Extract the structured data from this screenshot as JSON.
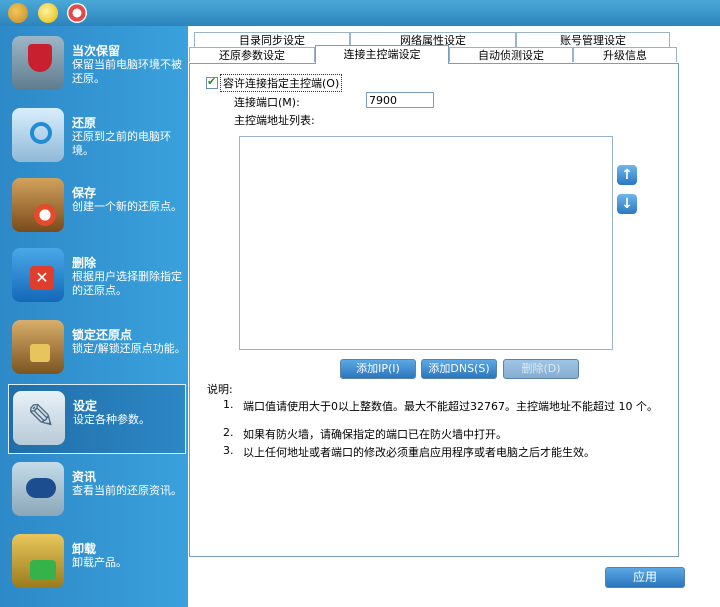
{
  "toolbar": {
    "icons": [
      "users-icon",
      "lightbulb-icon",
      "help-lifebuoy-icon"
    ]
  },
  "sidebar": {
    "items": [
      {
        "title": "当次保留",
        "desc": "保留当前电脑环境不被还原。",
        "icon": "shield-icon"
      },
      {
        "title": "还原",
        "desc": "还原到之前的电脑环境。",
        "icon": "restore-icon"
      },
      {
        "title": "保存",
        "desc": "创建一个新的还原点。",
        "icon": "save-icon"
      },
      {
        "title": "删除",
        "desc": "根据用户选择删除指定的还原点。",
        "icon": "delete-icon"
      },
      {
        "title": "锁定还原点",
        "desc": "锁定/解锁还原点功能。",
        "icon": "lock-icon"
      },
      {
        "title": "设定",
        "desc": "设定各种参数。",
        "icon": "settings-icon"
      },
      {
        "title": "资讯",
        "desc": "查看当前的还原资讯。",
        "icon": "info-icon"
      },
      {
        "title": "卸载",
        "desc": "卸载产品。",
        "icon": "uninstall-icon"
      }
    ],
    "active_index": 5
  },
  "tabs": {
    "row1": [
      "目录同步设定",
      "网络属性设定",
      "账号管理设定"
    ],
    "row2": [
      "还原参数设定",
      "连接主控端设定",
      "自动侦测设定",
      "升级信息"
    ],
    "active": "连接主控端设定"
  },
  "content": {
    "allow_checkbox_label": "容许连接指定主控端(O)",
    "allow_checked": true,
    "port_label": "连接端口(M):",
    "port_value": "7900",
    "address_list_label": "主控端地址列表:",
    "address_list": [],
    "buttons": {
      "add_ip": "添加IP(I)",
      "add_dns": "添加DNS(S)",
      "delete": "删除(D)"
    },
    "notes_title": "说明:",
    "notes": [
      {
        "num": "1.",
        "text": "端口值请使用大于0以上整数值。最大不能超过32767。主控端地址不能超过 10 个。"
      },
      {
        "num": "2.",
        "text": "如果有防火墙，请确保指定的端口已在防火墙中打开。"
      },
      {
        "num": "3.",
        "text": "以上任何地址或者端口的修改必须重启应用程序或者电脑之后才能生效。"
      }
    ],
    "apply_label": "应用"
  }
}
